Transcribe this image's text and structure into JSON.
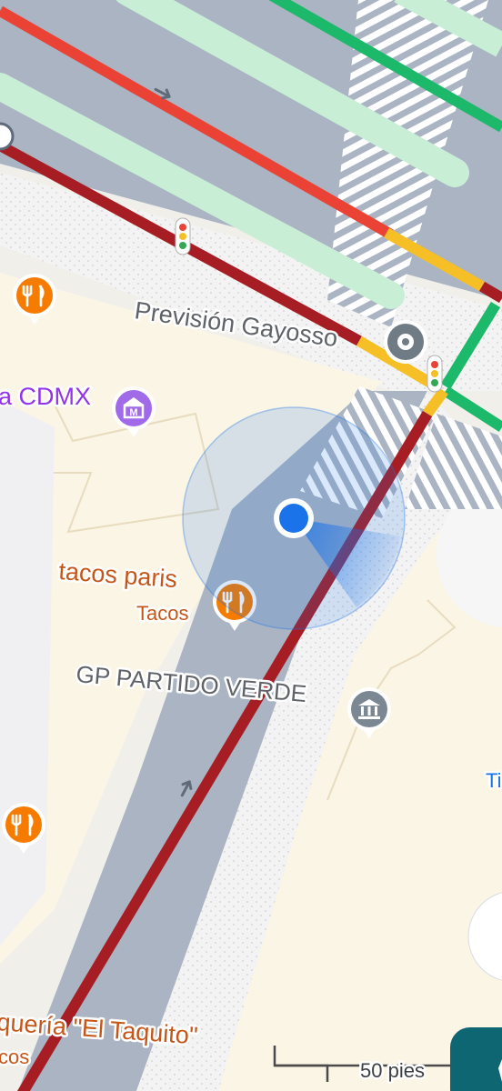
{
  "map": {
    "labels": {
      "prevision_gayosso": "Previsión Gayosso",
      "cdmx_partial": "a CDMX",
      "tacos_paris": "tacos paris",
      "tacos_paris_category": "Tacos",
      "gp_partido_verde": "GP PARTIDO VERDE",
      "right_edge_partial": "Ti",
      "taqueria_el_taquito": "quería \"El Taquito\"",
      "taqueria_category_partial": "cos"
    },
    "scale_bar": {
      "label": "50 pies"
    },
    "icons": {
      "restaurant": "restaurant-fork-knife-icon",
      "museum": "museum-icon",
      "funeral_home": "place-pin-icon",
      "government": "government-building-icon",
      "traffic_light": "traffic-light-icon",
      "direction_arrow": "one-way-arrow-icon",
      "my_location": "my-location-dot-icon"
    },
    "colors": {
      "traffic_heavy": "#a61e24",
      "traffic_slow": "#ea4335",
      "traffic_moderate": "#f6bf26",
      "traffic_free": "#1db96a",
      "location_blue": "#1a73e8",
      "restaurant_orange": "#f57c00",
      "museum_purple": "#9334e6",
      "road_gray": "#aab4c3",
      "building_cream": "#fbf5e6"
    }
  }
}
